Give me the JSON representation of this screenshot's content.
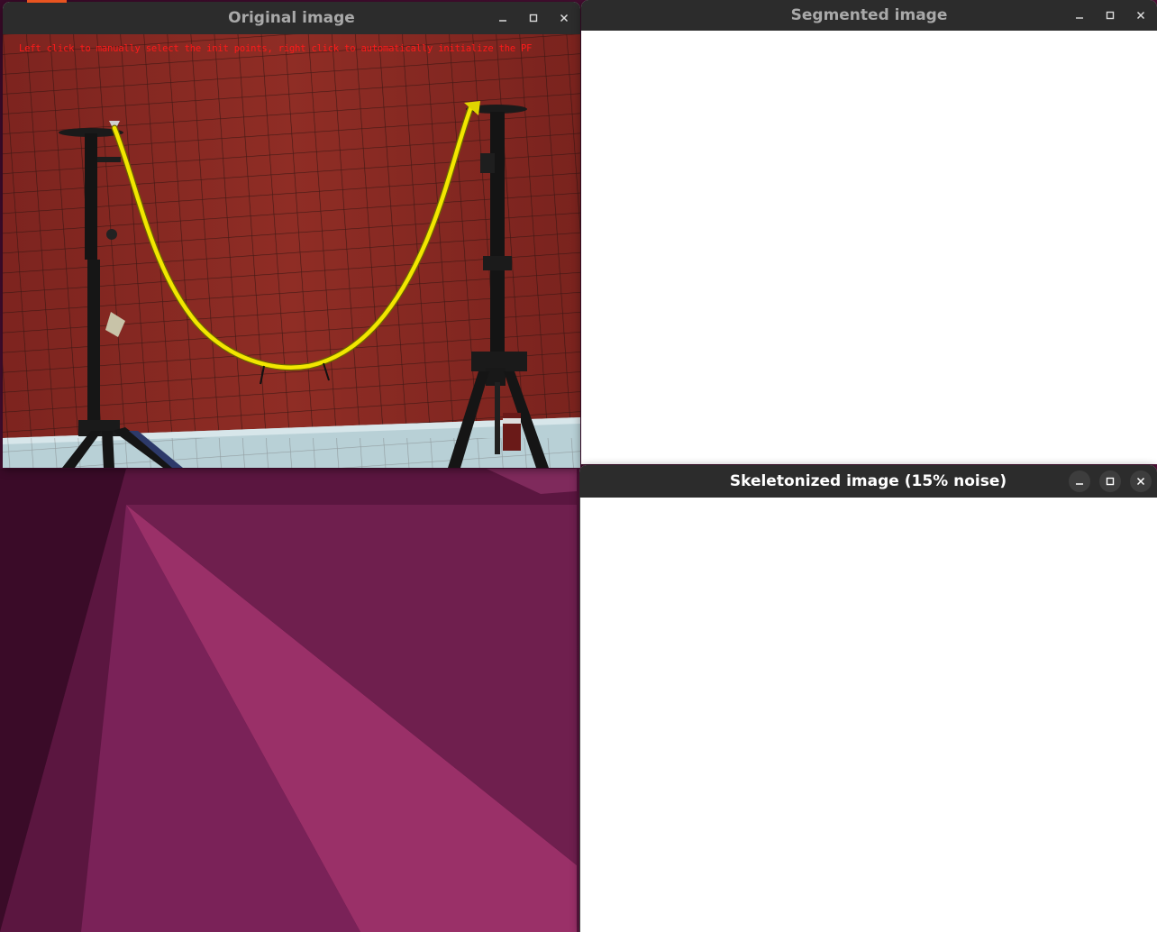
{
  "desktop": {
    "wallpaper_colors": [
      "#3b0a2a",
      "#5c1640",
      "#7a1f55",
      "#9a3068"
    ],
    "accent": "#e95420"
  },
  "windows": {
    "original": {
      "title": "Original image",
      "overlay_text": "Left click to manually select the init points, right click to automatically initialize the PF",
      "overlay_color": "#ff1a1a",
      "controls": [
        "minimize-icon",
        "maximize-icon",
        "close-icon"
      ]
    },
    "segmented": {
      "title": "Segmented image",
      "controls": [
        "minimize-icon",
        "maximize-icon",
        "close-icon"
      ]
    },
    "skeleton": {
      "title": "Skeletonized image (15% noise)",
      "controls": [
        "minimize-icon",
        "maximize-icon",
        "close-icon"
      ]
    }
  },
  "colors": {
    "titlebar": "#2c2c2c",
    "title_active": "#ffffff",
    "title_inactive": "#a9a9a9",
    "cable": "#f2e600",
    "backdrop": "#8a2a22"
  }
}
